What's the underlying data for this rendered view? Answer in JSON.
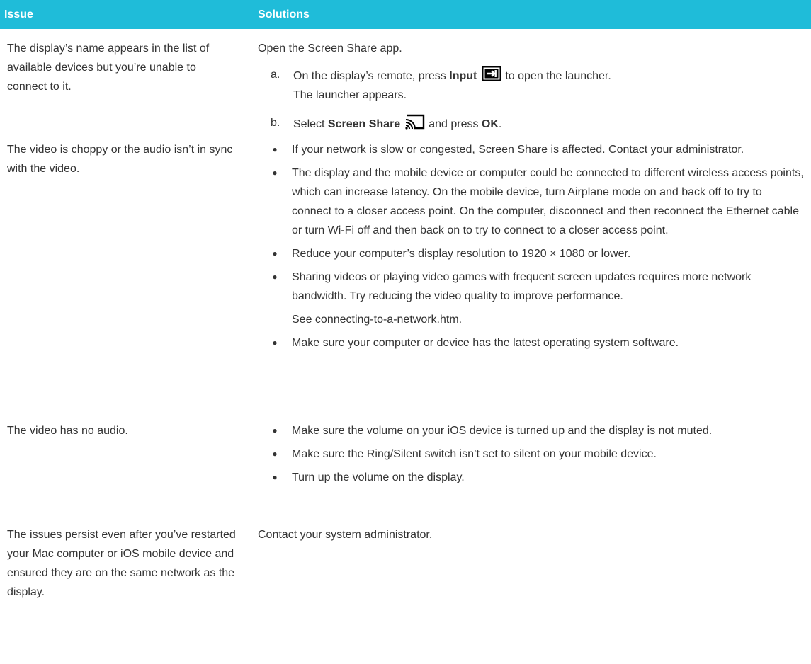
{
  "header": {
    "issue": "Issue",
    "solutions": "Solutions"
  },
  "rows": [
    {
      "issue": "The display’s name appears in the list of available devices but you’re unable to connect to it.",
      "intro": "Open the Screen Share app.",
      "steps": [
        {
          "letter": "a.",
          "pre": "On the display’s remote, press ",
          "bold": "Input",
          "icon": "input-icon",
          "post": "to open the launcher.",
          "sub": "The launcher appears."
        },
        {
          "letter": "b.",
          "pre": "Select ",
          "bold": "Screen Share",
          "icon": "screen-share-icon",
          "post": "and press ",
          "bold2": "OK",
          "post2": "."
        }
      ]
    },
    {
      "issue": "The video is choppy or the audio isn’t in sync with the video.",
      "bullets": [
        "If your network is slow or congested, Screen Share is affected. Contact your administrator.",
        "The display and the mobile device or computer could be connected to different wireless access points, which can increase latency. On the mobile device, turn Airplane mode on and back off to try to connect to a closer access point. On the computer, disconnect and then reconnect the Ethernet cable or turn Wi-Fi off and then back on to try to connect to a closer access point.",
        "Reduce your computer’s display resolution to 1920 × 1080 or lower.",
        "Sharing videos or playing video games with frequent screen updates requires more network bandwidth. Try reducing the video quality to improve performance."
      ],
      "see": "See connecting-to-a-network.htm.",
      "last_bullet": "Make sure your computer or device has the latest operating system software."
    },
    {
      "issue": "The video has no audio.",
      "bullets": [
        "Make sure the volume on your iOS device is turned up and the display is not muted.",
        "Make sure the Ring/Silent switch isn’t set to silent on your mobile device.",
        "Turn up the volume on the display."
      ]
    },
    {
      "issue": "The issues persist even after you’ve restarted your Mac computer or iOS mobile device and ensured they are on the same network as the display.",
      "solution": "Contact your system administrator."
    }
  ]
}
